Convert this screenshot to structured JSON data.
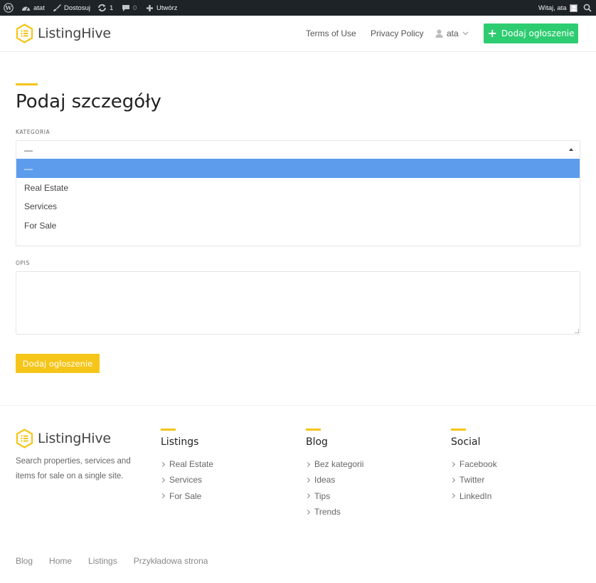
{
  "admin_bar": {
    "site_name": "atat",
    "customize": "Dostosuj",
    "updates_count": "1",
    "comments_count": "0",
    "new_label": "Utwórz",
    "greeting": "Witaj, ata"
  },
  "header": {
    "logo_text": "ListingHive",
    "nav": [
      "Terms of Use",
      "Privacy Policy"
    ],
    "user": "ata",
    "add_button": "Dodaj ogłoszenie"
  },
  "main": {
    "title": "Podaj szczegóły",
    "category_label": "KATEGORIA",
    "category_value": "—",
    "category_options": [
      "—",
      "Real Estate",
      "Services",
      "For Sale"
    ],
    "description_label": "OPIS",
    "description_value": "",
    "submit_label": "Dodaj ogłoszenie"
  },
  "footer": {
    "logo_text": "ListingHive",
    "description": "Search properties, services and items for sale on a single site.",
    "columns": [
      {
        "title": "Listings",
        "items": [
          "Real Estate",
          "Services",
          "For Sale"
        ]
      },
      {
        "title": "Blog",
        "items": [
          "Bez kategorii",
          "Ideas",
          "Tips",
          "Trends"
        ]
      },
      {
        "title": "Social",
        "items": [
          "Facebook",
          "Twitter",
          "LinkedIn"
        ]
      }
    ],
    "bottom_nav": [
      "Blog",
      "Home",
      "Listings",
      "Przykładowa strona"
    ]
  },
  "colors": {
    "accent_yellow": "#f5c518",
    "button_green": "#2ecc71",
    "selected_option": "#5d9cec",
    "admin_bar": "#1d2327"
  }
}
